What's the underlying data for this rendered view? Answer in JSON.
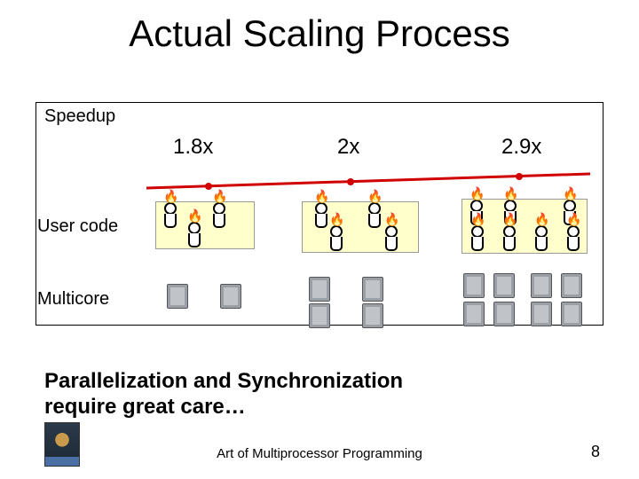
{
  "title": "Actual Scaling Process",
  "labels": {
    "speedup": "Speedup",
    "usercode": "User code",
    "multicore": "Multicore"
  },
  "speedup": {
    "values": [
      "1.8x",
      "2x",
      "2.9x"
    ]
  },
  "conclusion_line1": "Parallelization and Synchronization",
  "conclusion_line2": "require great care…",
  "footer": "Art of Multiprocessor Programming",
  "page": "8",
  "chart_data": {
    "type": "table",
    "title": "Actual Scaling Process",
    "columns": [
      "threads",
      "cores",
      "speedup"
    ],
    "rows": [
      {
        "threads": 3,
        "cores": 2,
        "speedup": 1.8
      },
      {
        "threads": 4,
        "cores": 4,
        "speedup": 2.0
      },
      {
        "threads": 7,
        "cores": 8,
        "speedup": 2.9
      }
    ],
    "annotations": [
      "threads on fire (contention)",
      "red trend line across speedup values"
    ]
  }
}
